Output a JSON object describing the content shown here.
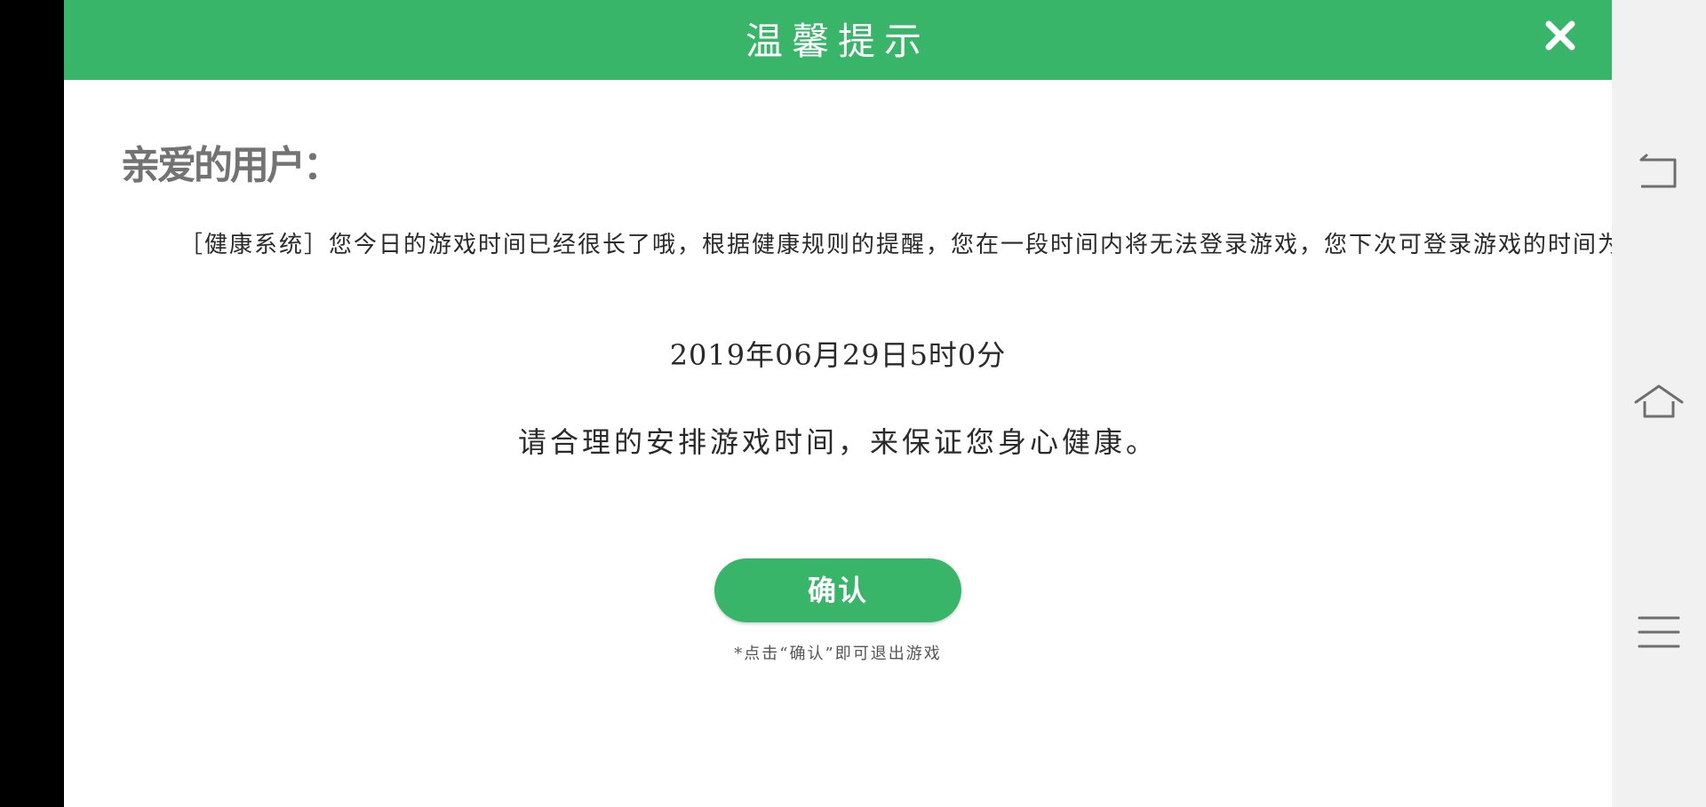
{
  "dialog": {
    "title": "温馨提示",
    "close_icon": "close-icon",
    "greeting": "亲爱的用户：",
    "message": "［健康系统］您今日的游戏时间已经很长了哦，根据健康规则的提醒，您在一段时间内将无法登录游戏，您下次可登录游戏的时间为",
    "next_login_time": "2019年06月29日5时0分",
    "advice": "请合理的安排游戏时间，来保证您身心健康。",
    "confirm_label": "确认",
    "confirm_note": "*点击“确认”即可退出游戏"
  },
  "navbar": {
    "back_icon": "back-icon",
    "home_icon": "home-icon",
    "menu_icon": "menu-icon"
  },
  "colors": {
    "accent_green": "#38b569",
    "greeting_gray": "#737373",
    "navbar_bg": "#f1f1f1"
  }
}
